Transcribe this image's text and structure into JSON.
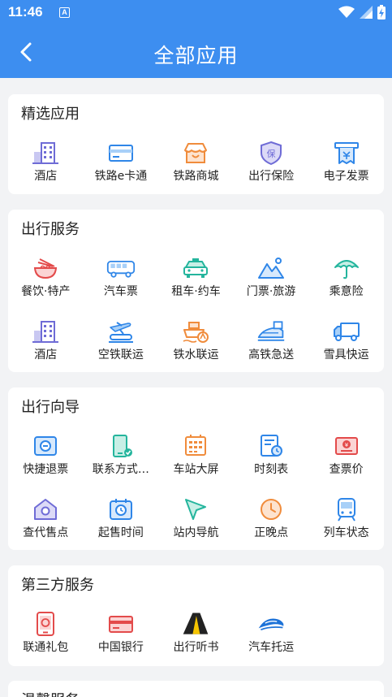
{
  "status": {
    "time": "11:46",
    "notify_letter": "A"
  },
  "appbar": {
    "title": "全部应用"
  },
  "sections": [
    {
      "title": "精选应用",
      "items": [
        {
          "label": "酒店",
          "icon": "hotel-icon"
        },
        {
          "label": "铁路e卡通",
          "icon": "card-icon"
        },
        {
          "label": "铁路商城",
          "icon": "shop-icon"
        },
        {
          "label": "出行保险",
          "icon": "insurance-icon"
        },
        {
          "label": "电子发票",
          "icon": "invoice-icon"
        }
      ]
    },
    {
      "title": "出行服务",
      "items": [
        {
          "label": "餐饮·特产",
          "icon": "food-icon"
        },
        {
          "label": "汽车票",
          "icon": "bus-icon"
        },
        {
          "label": "租车·约车",
          "icon": "taxi-icon"
        },
        {
          "label": "门票·旅游",
          "icon": "mountain-icon"
        },
        {
          "label": "乘意险",
          "icon": "umbrella-icon"
        },
        {
          "label": "酒店",
          "icon": "hotel-icon"
        },
        {
          "label": "空铁联运",
          "icon": "plane-train-icon"
        },
        {
          "label": "铁水联运",
          "icon": "ship-icon"
        },
        {
          "label": "高铁急送",
          "icon": "express-icon"
        },
        {
          "label": "雪具快运",
          "icon": "truck-icon"
        }
      ]
    },
    {
      "title": "出行向导",
      "items": [
        {
          "label": "快捷退票",
          "icon": "refund-icon"
        },
        {
          "label": "联系方式…",
          "icon": "phone-icon"
        },
        {
          "label": "车站大屏",
          "icon": "screen-icon"
        },
        {
          "label": "时刻表",
          "icon": "timetable-icon"
        },
        {
          "label": "查票价",
          "icon": "price-icon"
        },
        {
          "label": "查代售点",
          "icon": "agency-icon"
        },
        {
          "label": "起售时间",
          "icon": "calendar-clock-icon"
        },
        {
          "label": "站内导航",
          "icon": "navigation-icon"
        },
        {
          "label": "正晚点",
          "icon": "clock-icon"
        },
        {
          "label": "列车状态",
          "icon": "train-icon"
        }
      ]
    },
    {
      "title": "第三方服务",
      "items": [
        {
          "label": "联通礼包",
          "icon": "unicom-icon"
        },
        {
          "label": "中国银行",
          "icon": "bank-card-icon"
        },
        {
          "label": "出行听书",
          "icon": "audiobook-icon"
        },
        {
          "label": "汽车托运",
          "icon": "car-shipping-icon"
        }
      ]
    },
    {
      "title": "温馨服务",
      "items": []
    }
  ],
  "colors": {
    "primary": "#3d8ef0",
    "purple": "#6f6cd6",
    "blue": "#2f86e8",
    "orange": "#f08c3c",
    "teal": "#24b59d",
    "red": "#e34b4b"
  }
}
